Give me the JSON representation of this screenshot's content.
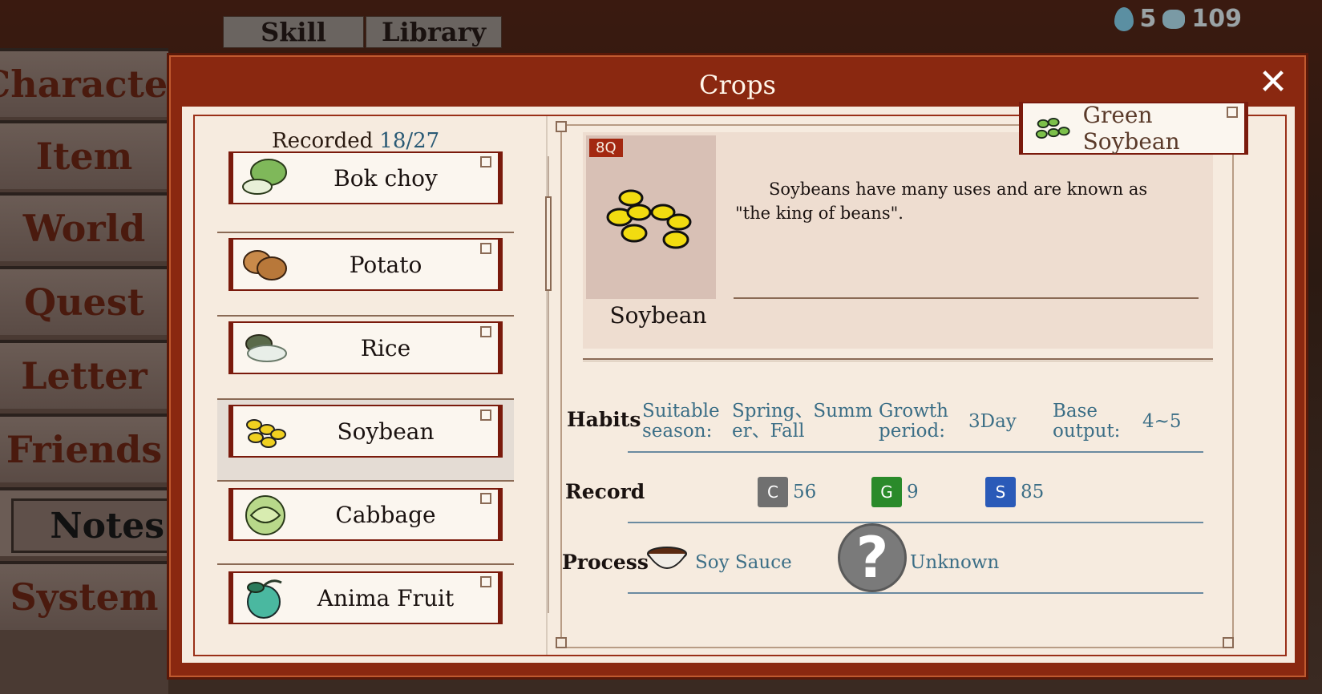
{
  "top_tabs": [
    "Skill",
    "Library"
  ],
  "currency": {
    "gems": "5",
    "ore": "109"
  },
  "side_menu": [
    "Character",
    "Item",
    "World",
    "Quest",
    "Letter",
    "Friends",
    "Notes",
    "System"
  ],
  "active_menu": "Notes",
  "modal": {
    "title": "Crops",
    "close_glyph": "✕"
  },
  "list": {
    "recorded_label": "Recorded",
    "recorded_count": "18/27",
    "items": [
      "Bok choy",
      "Potato",
      "Rice",
      "Soybean",
      "Cabbage",
      "Anima Fruit"
    ],
    "selected_index": 3
  },
  "variant_tab": {
    "label": "Green Soybean"
  },
  "detail": {
    "quality": "8Q",
    "name": "Soybean",
    "description": "Soybeans have many uses and are known as \"the king of beans\".",
    "habits": {
      "title": "Habits",
      "season_key": [
        "Suitable",
        "season:"
      ],
      "season_val": [
        "Spring、Summ",
        "er、Fall"
      ],
      "growth_key": [
        "Growth",
        "period:"
      ],
      "growth_val": "3Day",
      "output_key": [
        "Base",
        "output:"
      ],
      "output_val": "4~5"
    },
    "record": {
      "title": "Record",
      "c_label": "C",
      "c_value": "56",
      "g_label": "G",
      "g_value": "9",
      "s_label": "S",
      "s_value": "85"
    },
    "process": {
      "title": "Process",
      "product": "Soy Sauce",
      "unknown_glyph": "?",
      "unknown": "Unknown"
    }
  },
  "colors": {
    "accent_red": "#8a2810",
    "paper": "#f6ebdf",
    "stat_blue": "#3b6e86"
  }
}
